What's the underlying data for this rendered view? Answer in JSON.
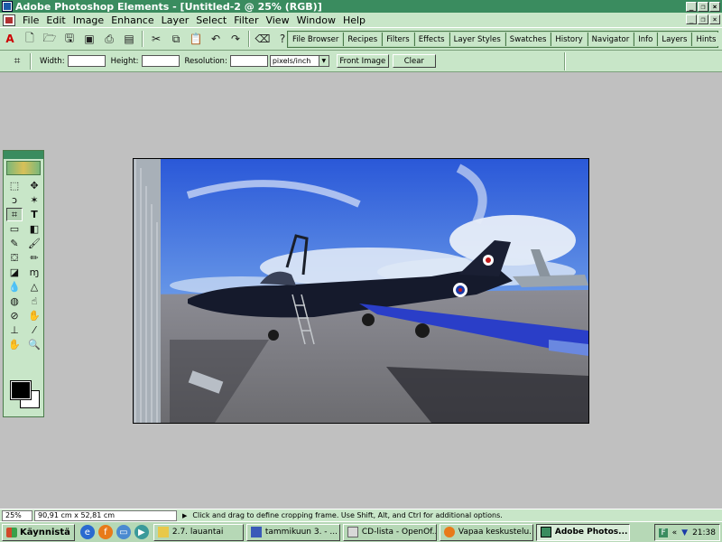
{
  "window": {
    "title": "Adobe Photoshop Elements - [Untitled-2 @ 25% (RGB)]"
  },
  "menu": [
    "File",
    "Edit",
    "Image",
    "Enhance",
    "Layer",
    "Select",
    "Filter",
    "View",
    "Window",
    "Help"
  ],
  "palette_tabs": [
    "File Browser",
    "Recipes",
    "Filters",
    "Effects",
    "Layer Styles",
    "Swatches",
    "History",
    "Navigator",
    "Info",
    "Layers",
    "Hints"
  ],
  "options_bar": {
    "width_label": "Width:",
    "width_value": "",
    "height_label": "Height:",
    "height_value": "",
    "resolution_label": "Resolution:",
    "resolution_value": "",
    "unit_select": "pixels/inch",
    "front_image_button": "Front Image",
    "clear_button": "Clear"
  },
  "status_bar": {
    "zoom": "25%",
    "doc_size": "90,91 cm x 52,81 cm",
    "hint": "Click and drag to define cropping frame. Use Shift, Alt, and Ctrl for additional options."
  },
  "taskbar": {
    "start_label": "Käynnistä",
    "tasks": [
      {
        "label": "2.7. lauantai",
        "active": false
      },
      {
        "label": "tammikuun 3. - ...",
        "active": false
      },
      {
        "label": "CD-lista - OpenOf...",
        "active": false
      },
      {
        "label": "Vapaa keskustelu...",
        "active": false
      },
      {
        "label": "Adobe Photos...",
        "active": true
      }
    ],
    "clock": "21:38"
  },
  "colors": {
    "title_bar": "#3a8c5f",
    "chrome": "#c8e6c8",
    "workspace": "#c0c0c0"
  }
}
